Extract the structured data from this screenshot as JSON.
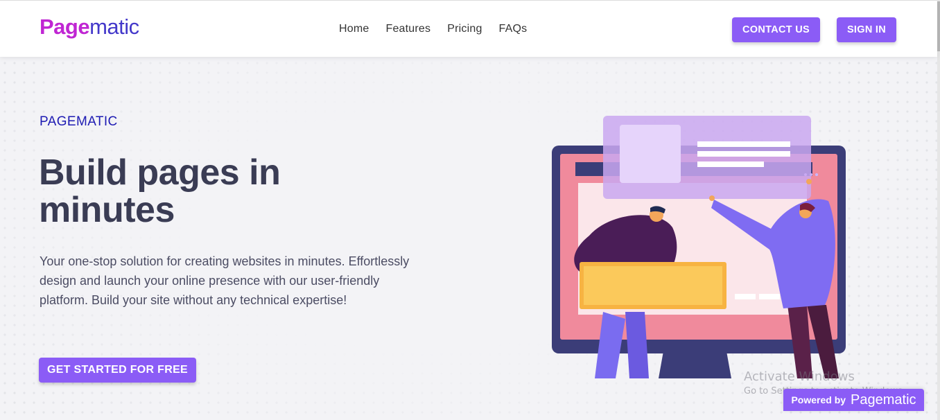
{
  "header": {
    "logo": {
      "part1": "Page",
      "part2": "matic"
    },
    "nav": [
      "Home",
      "Features",
      "Pricing",
      "FAQs"
    ],
    "contact_label": "CONTACT US",
    "signin_label": "SIGN IN"
  },
  "hero": {
    "eyebrow": "PAGEMATIC",
    "headline": "Build pages in minutes",
    "description": "Your one-stop solution for creating websites in minutes. Effortlessly design and launch your online presence with our user-friendly platform. Build your site without any technical expertise!",
    "cta_label": "GET STARTED FOR FREE"
  },
  "watermark": {
    "line1": "Activate Windows",
    "line2": "Go to Settings to activate Windows."
  },
  "badge": {
    "prefix": "Powered by",
    "brand": "Pagematic"
  },
  "colors": {
    "accent": "#8b5cf6",
    "brand_pink": "#c026d3",
    "brand_indigo": "#4338ca",
    "heading": "#3a3c54",
    "background": "#f3f3f6"
  }
}
